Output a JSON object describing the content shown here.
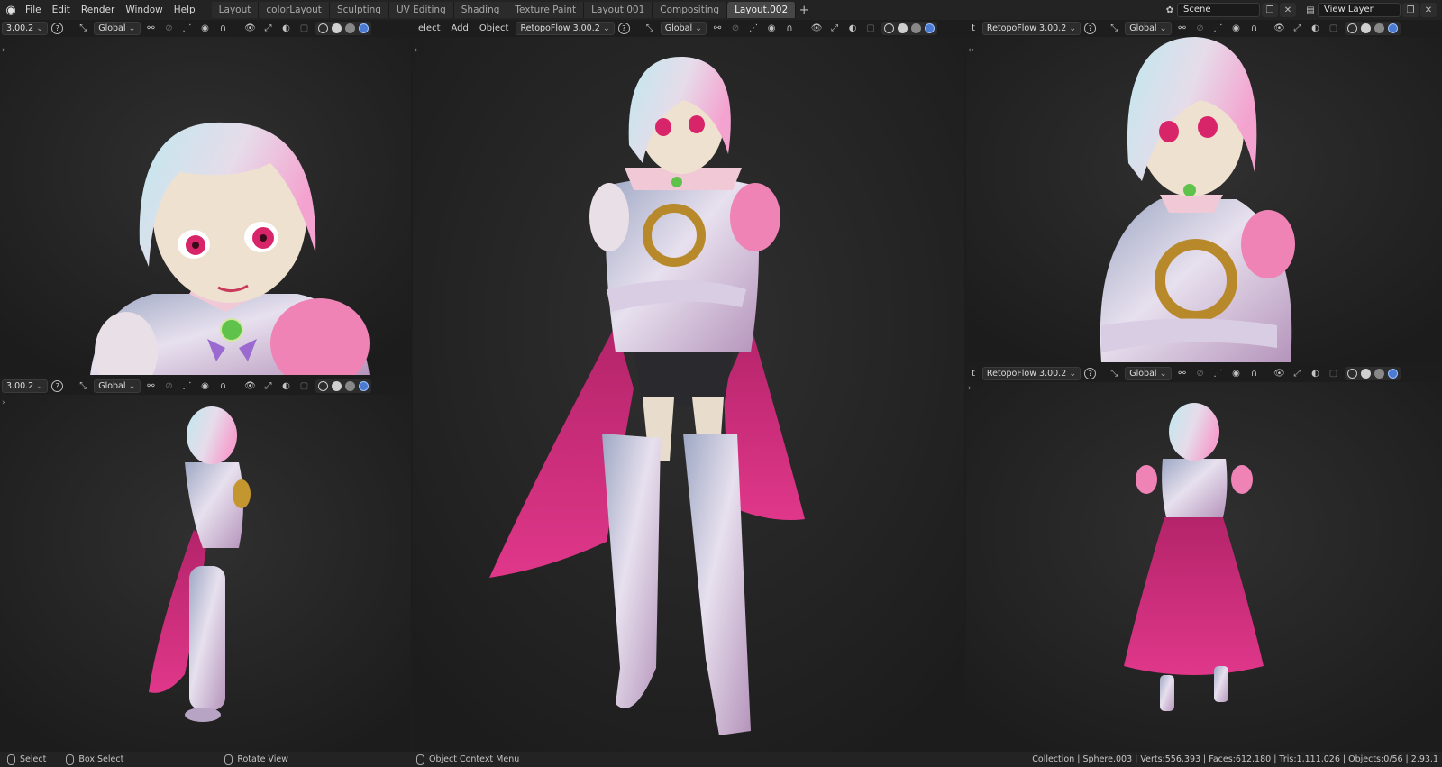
{
  "topbar": {
    "menus": [
      "File",
      "Edit",
      "Render",
      "Window",
      "Help"
    ],
    "tabs": [
      "Layout",
      "colorLayout",
      "Sculpting",
      "UV Editing",
      "Shading",
      "Texture Paint",
      "Layout.001",
      "Compositing",
      "Layout.002"
    ],
    "active_tab": "Layout.002",
    "scene": "Scene",
    "view_layer": "View Layer"
  },
  "viewport_header": {
    "retopo_short": "3.00.2",
    "retopo_full": "RetopoFlow 3.00.2",
    "transform": "Global",
    "menu_select": "Select",
    "menu_select_trunc": "elect",
    "menu_add": "Add",
    "menu_object": "Object",
    "trunc_t": "t"
  },
  "statusbar": {
    "select": "Select",
    "box_select": "Box Select",
    "rotate_view": "Rotate View",
    "context_menu": "Object Context Menu",
    "stats": "Collection | Sphere.003 | Verts:556,393 | Faces:612,180 | Tris:1,111,026 | Objects:0/56 | 2.93.1"
  },
  "colors": {
    "hair": "#d7e2ea",
    "hair_tint": "#f0a9d2",
    "skin": "#efe1cf",
    "armor": "#c7b9cf",
    "cape": "#d0317c",
    "gold": "#b8892a",
    "eye": "#d8256a",
    "viewport_bg": "#262626"
  }
}
